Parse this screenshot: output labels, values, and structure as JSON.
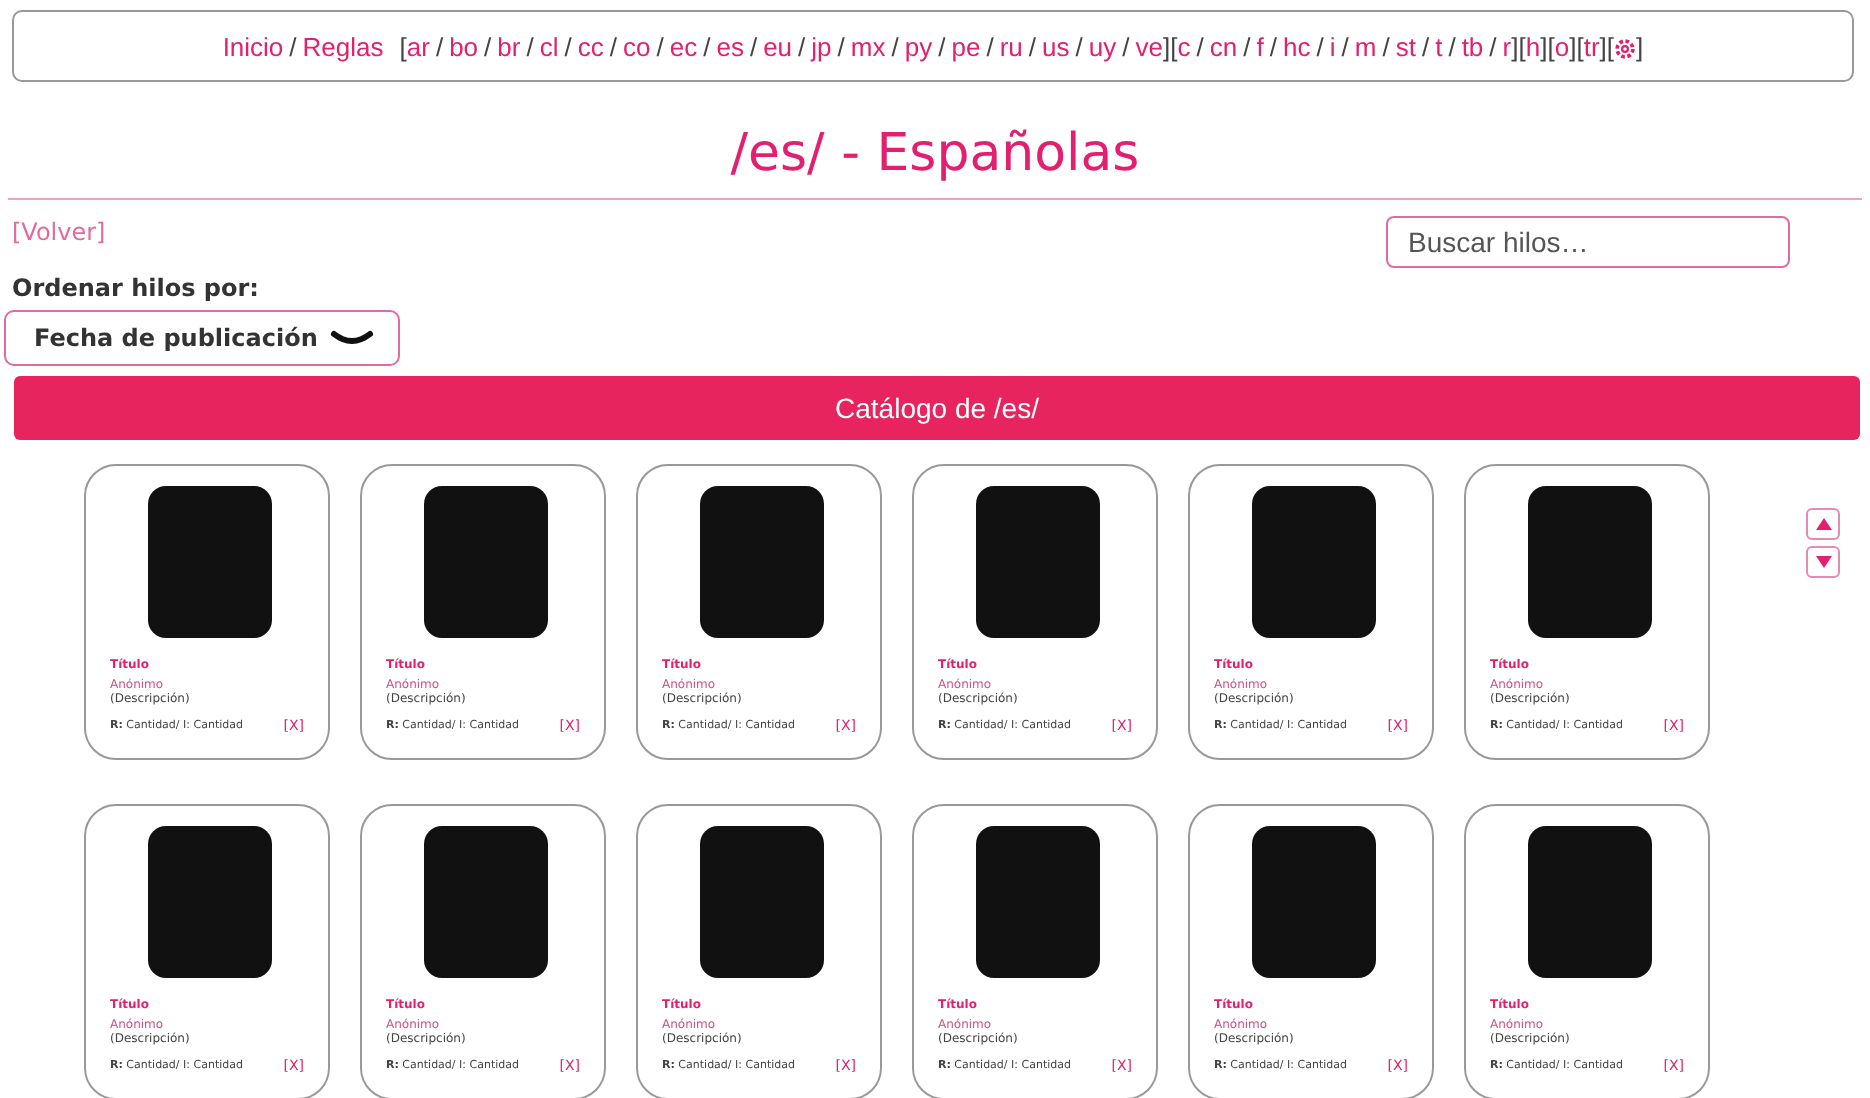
{
  "nav": {
    "separator": "/",
    "brackets": [
      "[",
      "]"
    ],
    "home_links": [
      "Inicio",
      "Reglas"
    ],
    "groups": [
      [
        "ar",
        "bo",
        "br",
        "cl",
        "cc",
        "co",
        "ec",
        "es",
        "eu",
        "jp",
        "mx",
        "py",
        "pe",
        "ru",
        "us",
        "uy",
        "ve"
      ],
      [
        "c",
        "cn",
        "f",
        "hc",
        "i",
        "m",
        "st",
        "t",
        "tb",
        "r"
      ],
      [
        "h"
      ],
      [
        "o"
      ],
      [
        "tr"
      ]
    ],
    "settings_link": true
  },
  "title": "/es/ - Españolas",
  "back_link": "[Volver]",
  "search": {
    "placeholder": "Buscar hilos…"
  },
  "sort": {
    "label": "Ordenar hilos por:",
    "value": "Fecha de publicación"
  },
  "catalog_header": "Catálogo de /es/",
  "threads": [
    {
      "title": "Título",
      "author": "Anónimo",
      "description": "(Descripción)",
      "counts": "**R:** Cantidad/ I: Cantidad",
      "hide": "[X]"
    },
    {
      "title": "Título",
      "author": "Anónimo",
      "description": "(Descripción)",
      "counts": "**R:** Cantidad/ I: Cantidad",
      "hide": "[X]"
    },
    {
      "title": "Título",
      "author": "Anónimo",
      "description": "(Descripción)",
      "counts": "**R:** Cantidad/ I: Cantidad",
      "hide": "[X]"
    },
    {
      "title": "Título",
      "author": "Anónimo",
      "description": "(Descripción)",
      "counts": "**R:** Cantidad/ I: Cantidad",
      "hide": "[X]"
    },
    {
      "title": "Título",
      "author": "Anónimo",
      "description": "(Descripción)",
      "counts": "**R:** Cantidad/ I: Cantidad",
      "hide": "[X]"
    },
    {
      "title": "Título",
      "author": "Anónimo",
      "description": "(Descripción)",
      "counts": "**R:** Cantidad/ I: Cantidad",
      "hide": "[X]"
    },
    {
      "title": "Título",
      "author": "Anónimo",
      "description": "(Descripción)",
      "counts": "**R:** Cantidad/ I: Cantidad",
      "hide": "[X]"
    },
    {
      "title": "Título",
      "author": "Anónimo",
      "description": "(Descripción)",
      "counts": "**R:** Cantidad/ I: Cantidad",
      "hide": "[X]"
    },
    {
      "title": "Título",
      "author": "Anónimo",
      "description": "(Descripción)",
      "counts": "**R:** Cantidad/ I: Cantidad",
      "hide": "[X]"
    },
    {
      "title": "Título",
      "author": "Anónimo",
      "description": "(Descripción)",
      "counts": "**R:** Cantidad/ I: Cantidad",
      "hide": "[X]"
    },
    {
      "title": "Título",
      "author": "Anónimo",
      "description": "(Descripción)",
      "counts": "**R:** Cantidad/ I: Cantidad",
      "hide": "[X]"
    },
    {
      "title": "Título",
      "author": "Anónimo",
      "description": "(Descripción)",
      "counts": "**R:** Cantidad/ I: Cantidad",
      "hide": "[X]"
    }
  ],
  "scroll_buttons": true
}
